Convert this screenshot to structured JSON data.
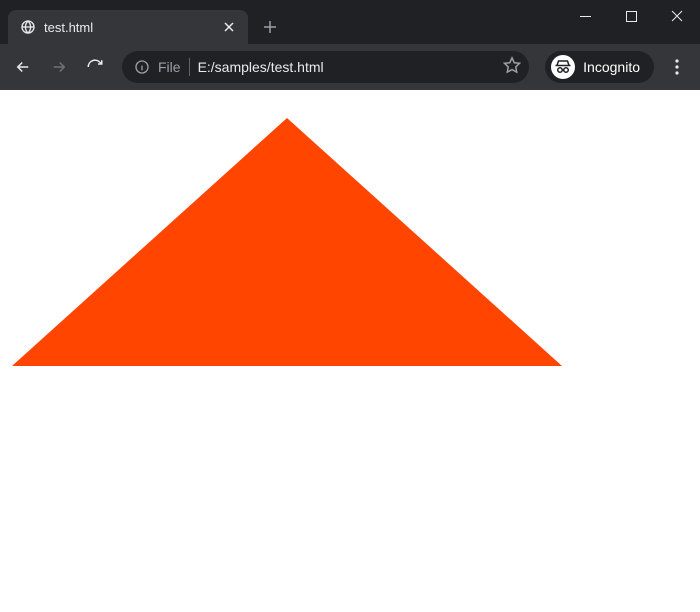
{
  "window": {
    "minimize_icon": "minimize-icon",
    "maximize_icon": "maximize-icon",
    "close_icon": "close-icon"
  },
  "tab": {
    "title": "test.html",
    "favicon": "globe-icon",
    "close_icon": "close-tab-icon",
    "newtab_icon": "plus-icon"
  },
  "toolbar": {
    "back_icon": "arrow-left-icon",
    "forward_icon": "arrow-right-icon",
    "reload_icon": "reload-icon",
    "menu_icon": "kebab-menu-icon"
  },
  "omnibox": {
    "info_icon": "info-icon",
    "prefix_label": "File",
    "url_value": "E:/samples/test.html",
    "bookmark_icon": "star-icon"
  },
  "incognito": {
    "icon": "incognito-icon",
    "label": "Incognito"
  },
  "content": {
    "shape": "orange-triangle",
    "fill": "#ff4500"
  }
}
